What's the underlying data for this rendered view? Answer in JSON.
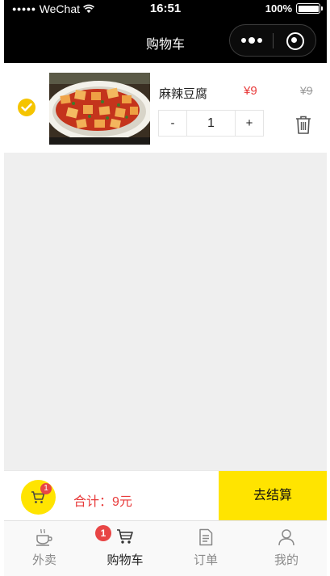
{
  "status_bar": {
    "signal_dots": "●●●●●",
    "carrier": "WeChat",
    "time": "16:51",
    "battery_pct": "100%"
  },
  "nav": {
    "title": "购物车"
  },
  "cart": {
    "items": [
      {
        "name": "麻辣豆腐",
        "price": "¥9",
        "original_price": "¥9",
        "quantity": "1",
        "checked": true
      }
    ],
    "stepper": {
      "minus": "-",
      "plus": "+"
    }
  },
  "checkout": {
    "cart_count": "1",
    "total_text": "合计：9元",
    "settle_label": "去结算"
  },
  "tabbar": {
    "tabs": [
      {
        "label": "外卖",
        "icon": "coffee-cup-icon"
      },
      {
        "label": "购物车",
        "icon": "cart-icon",
        "badge": "1",
        "active": true
      },
      {
        "label": "订单",
        "icon": "order-list-icon"
      },
      {
        "label": "我的",
        "icon": "user-icon"
      }
    ]
  },
  "colors": {
    "accent_yellow": "#ffe400",
    "price_red": "#e83a3a",
    "nav_black": "#000000",
    "badge_red": "#e84545"
  }
}
